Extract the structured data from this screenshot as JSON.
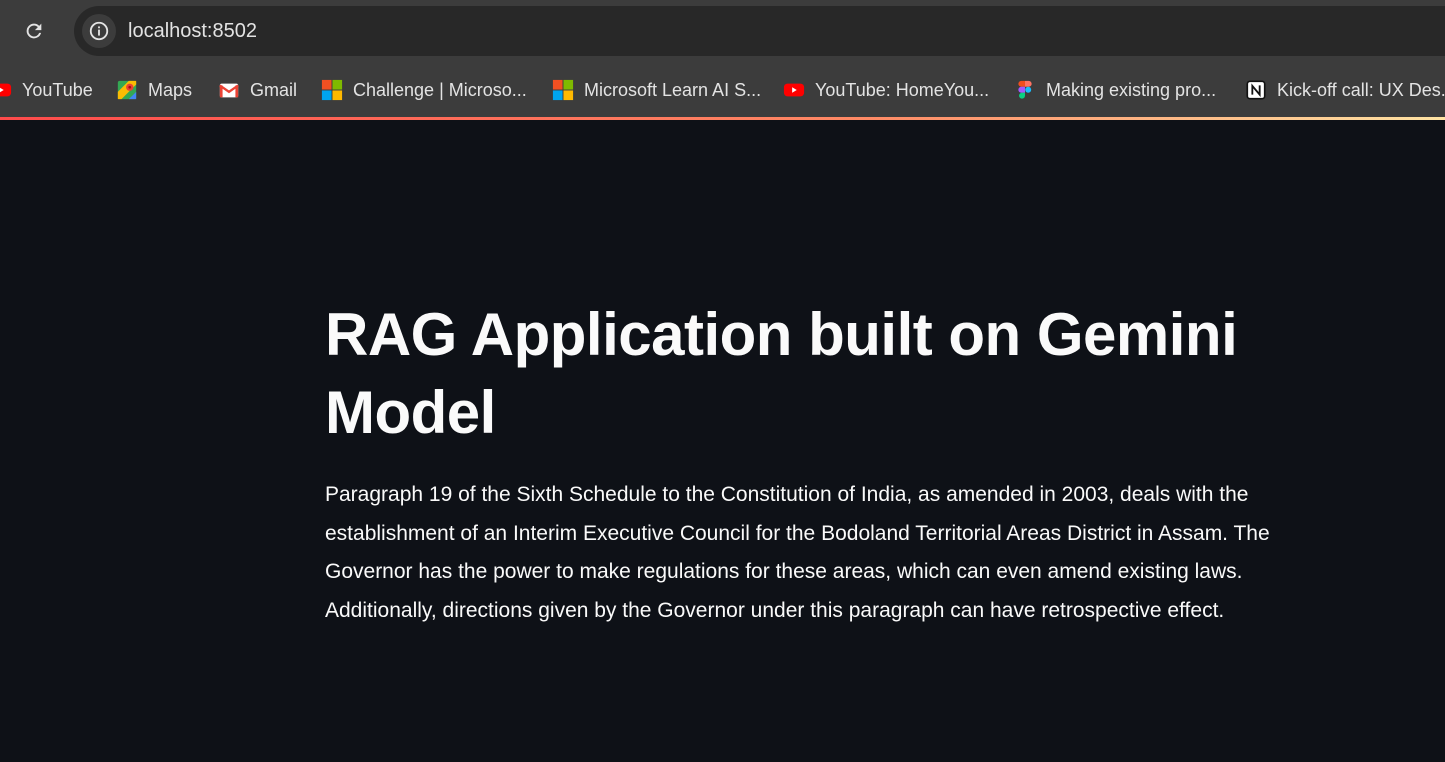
{
  "browser": {
    "url": "localhost:8502",
    "bookmarks": [
      {
        "label": "YouTube",
        "icon": "youtube-icon"
      },
      {
        "label": "Maps",
        "icon": "maps-icon"
      },
      {
        "label": "Gmail",
        "icon": "gmail-icon"
      },
      {
        "label": "Challenge | Microso...",
        "icon": "microsoft-icon"
      },
      {
        "label": "Microsoft Learn AI S...",
        "icon": "microsoft-icon"
      },
      {
        "label": "YouTube: HomeYou...",
        "icon": "youtube-icon"
      },
      {
        "label": "Making existing pro...",
        "icon": "figma-icon"
      },
      {
        "label": "Kick-off call: UX Des...",
        "icon": "notion-icon"
      }
    ]
  },
  "app": {
    "title": "RAG Application built on Gemini Model",
    "answer": "Paragraph 19 of the Sixth Schedule to the Constitution of India, as amended in 2003, deals with the establishment of an Interim Executive Council for the Bodoland Territorial Areas District in Assam. The Governor has the power to make regulations for these areas, which can even amend existing laws. Additionally, directions given by the Governor under this paragraph can have retrospective effect."
  },
  "colors": {
    "background": "#0e1117",
    "text": "#fafafa",
    "chrome": "#3c3c3c",
    "accent": "#ff4b4b"
  }
}
